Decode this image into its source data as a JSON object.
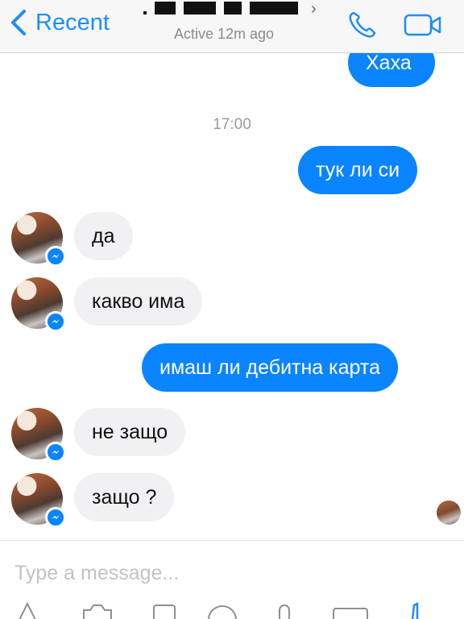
{
  "header": {
    "back_label": "Recent",
    "status": "Active 12m ago"
  },
  "icons": {
    "back": "chevron-left-icon",
    "call": "phone-icon",
    "video": "video-camera-icon",
    "messenger_badge": "messenger-icon"
  },
  "colors": {
    "accent": "#1f8ef1",
    "outgoing_bubble": "#0a84ff",
    "incoming_bubble": "#f1f1f3"
  },
  "conversation": {
    "partial_top": "Хаха",
    "timestamp": "17:00",
    "messages": [
      {
        "dir": "out",
        "text": "тук ли си"
      },
      {
        "dir": "in",
        "text": "да"
      },
      {
        "dir": "in",
        "text": "какво има"
      },
      {
        "dir": "out",
        "text": "имаш ли дебитна карта"
      },
      {
        "dir": "in",
        "text": "не защо"
      },
      {
        "dir": "in",
        "text": "защо ?"
      }
    ]
  },
  "composer": {
    "placeholder": "Type a message..."
  }
}
